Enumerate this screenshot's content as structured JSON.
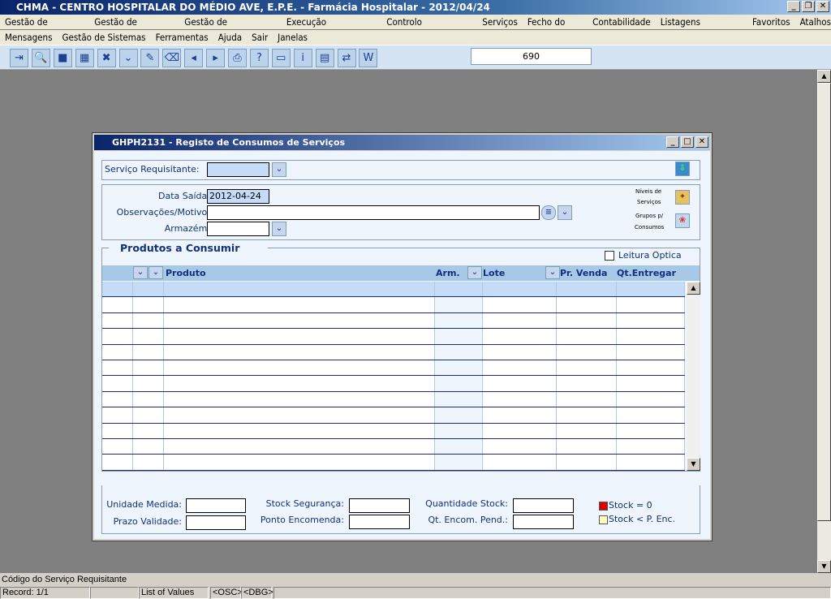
{
  "app": {
    "title": "CHMA - CENTRO HOSPITALAR DO MÉDIO AVE, E.P.E.  -  Farmácia Hospitalar  -  2012/04/24",
    "window_buttons": [
      "_",
      "❐",
      "✕"
    ]
  },
  "menu_row1": [
    "Gestão de Produtos",
    "Gestão de Compras",
    "Gestão de Requisições",
    "Execução Operacional",
    "Controlo Operacional",
    "Serviços",
    "Fecho do Mês",
    "Contabilidade",
    "Listagens Genéricas",
    "Favoritos",
    "Atalhos"
  ],
  "menu_row2": [
    "Mensagens",
    "Gestão de Sistemas",
    "Ferramentas",
    "Ajuda",
    "Sair",
    "Janelas"
  ],
  "toolbar": {
    "icons": [
      "exit-icon",
      "search-icon",
      "save-icon",
      "insert-record-icon",
      "delete-record-icon",
      "list-of-values-icon",
      "edit-icon",
      "clear-icon",
      "previous-record-icon",
      "next-record-icon",
      "print-icon",
      "help-icon",
      "keys-icon",
      "info-icon",
      "calculator-icon",
      "switch-user-icon",
      "word-icon"
    ],
    "counter": "690"
  },
  "dialog": {
    "title": "GHPH2131 - Registo de Consumos de Serviços",
    "servico_label": "Serviço Requisitante:",
    "servico_value": "",
    "data_saida_label": "Data Saída:",
    "data_saida_value": "2012-04-24",
    "observacoes_label": "Observações/Motivo:",
    "observacoes_value": "",
    "armazem_label": "Armazém:",
    "armazem_value": "",
    "niveis_label_1": "Níveis de",
    "niveis_label_2": "Serviços",
    "grupos_label_1": "Grupos p/",
    "grupos_label_2": "Consumos",
    "section_title": "Produtos a Consumir",
    "leitura_optica": "Leitura Optica",
    "leitura_optica_checked": false,
    "columns": [
      "Produto",
      "Arm.",
      "Lote",
      "Pr. Venda",
      "Qt.Entregar"
    ],
    "row_count": 12,
    "unidade_medida_label": "Unidade Medida:",
    "prazo_validade_label": "Prazo Validade:",
    "stock_seguranca_label": "Stock Segurança:",
    "ponto_encomenda_label": "Ponto Encomenda:",
    "quantidade_stock_label": "Quantidade Stock:",
    "qt_encom_label": "Qt. Encom. Pend.:",
    "legend": [
      {
        "label": "Stock = 0",
        "color": "#e00000"
      },
      {
        "label": "Stock < P. Enc.",
        "color": "#ffffc0"
      }
    ]
  },
  "status": {
    "message": "Código do Serviço Requisitante",
    "record": "Record: 1/1",
    "lov": "List of Values",
    "osc": "<OSC>",
    "dbg": "<DBG>"
  }
}
